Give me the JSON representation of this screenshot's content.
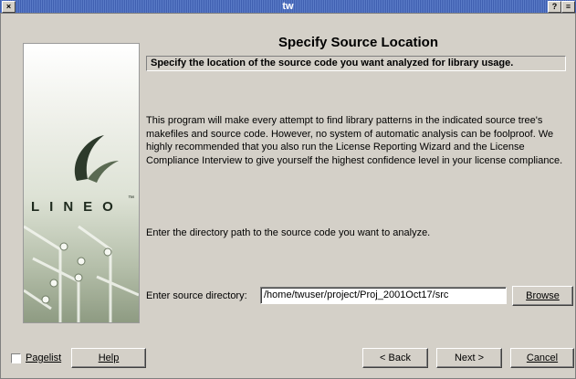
{
  "window": {
    "title": "tw",
    "close_glyph": "×",
    "help_glyph": "?",
    "menu_glyph": "≡"
  },
  "sidebar": {
    "logo_text": "LINEO",
    "logo_mark": "™"
  },
  "page": {
    "heading": "Specify Source Location",
    "subheading": "Specify the location of the source code you want analyzed for library usage.",
    "description": "This program will make every attempt to find library patterns in the indicated source tree's makefiles and source code. However, no system of automatic analysis can be foolproof. We highly recommended that you also run the License Reporting Wizard and the License Compliance Interview to give yourself the highest confidence level in your license compliance.",
    "prompt": "Enter the directory path to the source code you want to analyze.",
    "source_label": "Enter source directory:",
    "source_value": "/home/twuser/project/Proj_2001Oct17/src",
    "browse_label": "Browse"
  },
  "footer": {
    "pagelist_label": "Pagelist",
    "pagelist_checked": false,
    "help_label": "Help",
    "back_label": "< Back",
    "next_label": "Next >",
    "cancel_label": "Cancel"
  }
}
